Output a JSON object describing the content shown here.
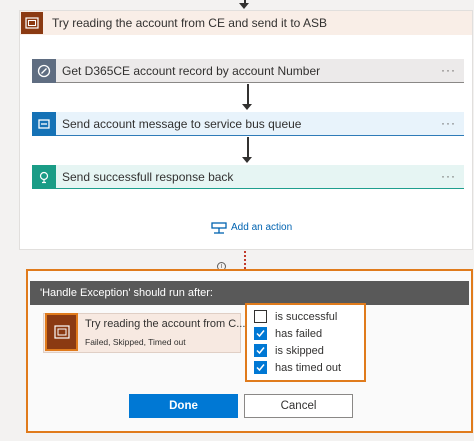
{
  "scope": {
    "title": "Try reading the account from CE and send it to ASB",
    "icon": "scope-icon"
  },
  "actions": [
    {
      "label": "Get D365CE account record by account Number",
      "icon": "dynamics-icon",
      "more": "···"
    },
    {
      "label": "Send account message to service bus queue",
      "icon": "service-bus-icon",
      "more": "···"
    },
    {
      "label": "Send successfull response back",
      "icon": "response-icon",
      "more": "···"
    }
  ],
  "add_action": {
    "label": "Add an action"
  },
  "run_after": {
    "header": "'Handle Exception' should run after:",
    "predecessor": {
      "title": "Try reading the account from C...",
      "statuses": "Failed, Skipped, Timed out"
    },
    "conditions": [
      {
        "label": "is successful",
        "checked": false
      },
      {
        "label": "has failed",
        "checked": true
      },
      {
        "label": "is skipped",
        "checked": true
      },
      {
        "label": "has timed out",
        "checked": true
      }
    ],
    "done_label": "Done",
    "cancel_label": "Cancel"
  },
  "colors": {
    "highlight": "#e07b1c",
    "scope_brand": "#8b3a12",
    "primary": "#0078d4"
  }
}
